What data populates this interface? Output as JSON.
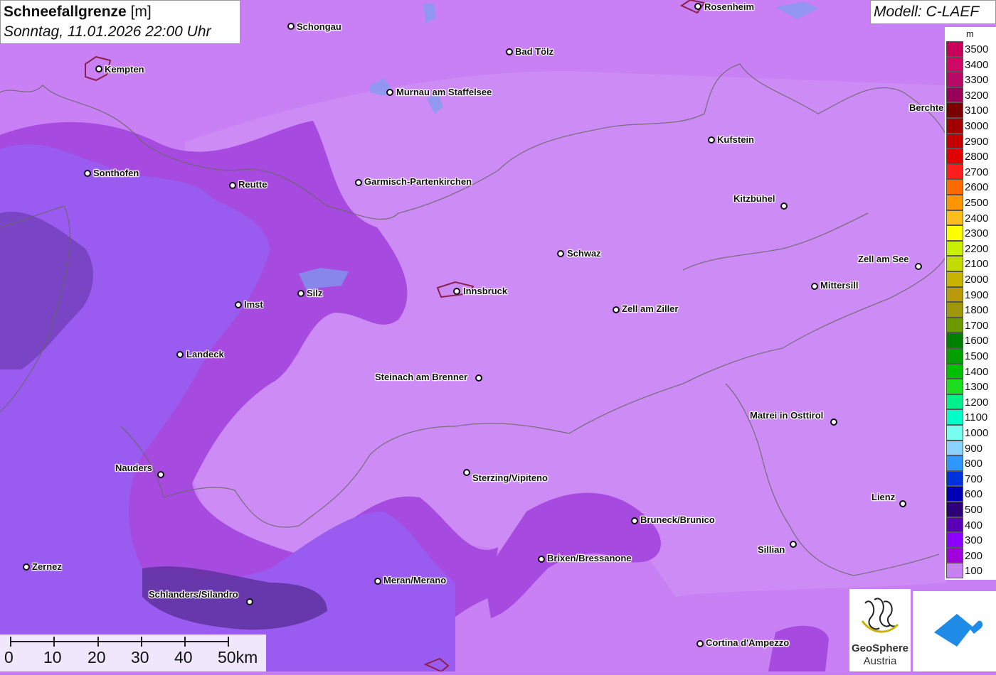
{
  "title": {
    "bold": "Schneefallgrenze",
    "unit": " [m]",
    "subtitle": "Sonntag, 11.01.2026 22:00 Uhr"
  },
  "model": "Modell: C-LAEF",
  "legend": {
    "unit": "m",
    "entries": [
      {
        "label": "3500",
        "color": "#c8005a"
      },
      {
        "label": "3400",
        "color": "#cc0a66"
      },
      {
        "label": "3300",
        "color": "#b60a66"
      },
      {
        "label": "3200",
        "color": "#98005a"
      },
      {
        "label": "3100",
        "color": "#7a0000"
      },
      {
        "label": "3000",
        "color": "#a00000"
      },
      {
        "label": "2900",
        "color": "#c40000"
      },
      {
        "label": "2800",
        "color": "#e00000"
      },
      {
        "label": "2700",
        "color": "#ff1e1e"
      },
      {
        "label": "2600",
        "color": "#ff6a00"
      },
      {
        "label": "2500",
        "color": "#ff9600"
      },
      {
        "label": "2400",
        "color": "#ffbe1e"
      },
      {
        "label": "2300",
        "color": "#ffff00"
      },
      {
        "label": "2200",
        "color": "#c8f000"
      },
      {
        "label": "2100",
        "color": "#c3dc00"
      },
      {
        "label": "2000",
        "color": "#c8b400"
      },
      {
        "label": "1900",
        "color": "#b89a0a"
      },
      {
        "label": "1800",
        "color": "#a0960a"
      },
      {
        "label": "1700",
        "color": "#6a9a00"
      },
      {
        "label": "1600",
        "color": "#008000"
      },
      {
        "label": "1500",
        "color": "#00a000"
      },
      {
        "label": "1400",
        "color": "#00be00"
      },
      {
        "label": "1300",
        "color": "#1edc1e"
      },
      {
        "label": "1200",
        "color": "#00f08c"
      },
      {
        "label": "1100",
        "color": "#00ffc8"
      },
      {
        "label": "1000",
        "color": "#78fff0"
      },
      {
        "label": "900",
        "color": "#8cd2ff"
      },
      {
        "label": "800",
        "color": "#3296ff"
      },
      {
        "label": "700",
        "color": "#0032dc"
      },
      {
        "label": "600",
        "color": "#0000b4"
      },
      {
        "label": "500",
        "color": "#2d0078"
      },
      {
        "label": "400",
        "color": "#5a00b4"
      },
      {
        "label": "300",
        "color": "#8c00ff"
      },
      {
        "label": "200",
        "color": "#a000dc"
      },
      {
        "label": "100",
        "color": "#c882f0"
      }
    ]
  },
  "cities": [
    {
      "name": "Rosenheim"
    },
    {
      "name": "Schongau"
    },
    {
      "name": "Kempten"
    },
    {
      "name": "Bad Tölz"
    },
    {
      "name": "Murnau am Staffelsee"
    },
    {
      "name": "Kufstein"
    },
    {
      "name": "Sonthofen"
    },
    {
      "name": "Reutte"
    },
    {
      "name": "Garmisch-Partenkirchen"
    },
    {
      "name": "Kitzbühel"
    },
    {
      "name": "Schwaz"
    },
    {
      "name": "Zell am See"
    },
    {
      "name": "Imst"
    },
    {
      "name": "Silz"
    },
    {
      "name": "Innsbruck"
    },
    {
      "name": "Mittersill"
    },
    {
      "name": "Zell am Ziller"
    },
    {
      "name": "Landeck"
    },
    {
      "name": "Steinach am Brenner"
    },
    {
      "name": "Matrei in Osttirol"
    },
    {
      "name": "Nauders"
    },
    {
      "name": "Sterzing/Vipiteno"
    },
    {
      "name": "Lienz"
    },
    {
      "name": "Bruneck/Brunico"
    },
    {
      "name": "Sillian"
    },
    {
      "name": "Brixen/Bressanone"
    },
    {
      "name": "Zernez"
    },
    {
      "name": "Meran/Merano"
    },
    {
      "name": "Schlanders/Silandro"
    },
    {
      "name": "Cortina d'Ampezzo"
    },
    {
      "name": "Berchte"
    }
  ],
  "scale": {
    "labels": [
      "0",
      "10",
      "20",
      "30",
      "40",
      "50km"
    ]
  },
  "logos": {
    "geosphere_line1": "GeoSphere",
    "geosphere_line2": "Austria"
  }
}
